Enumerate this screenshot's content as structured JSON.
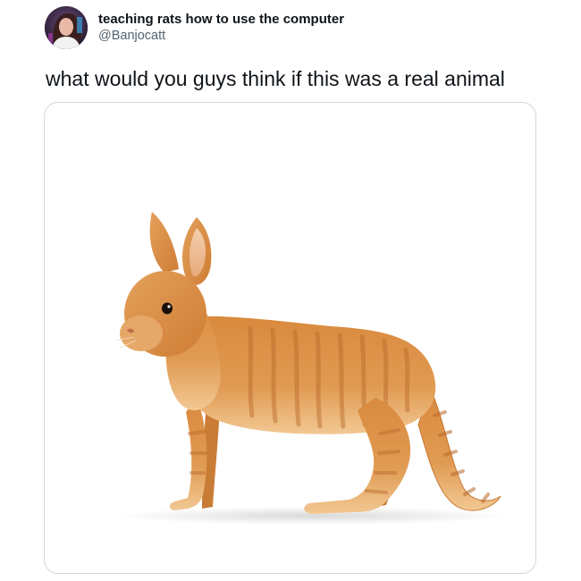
{
  "tweet": {
    "author": {
      "display_name": "teaching rats how to use the computer",
      "handle": "@Banjocatt",
      "avatar_icon": "profile-avatar"
    },
    "text": "what would you guys think if this was a real animal",
    "media": {
      "icon": "rabbit-cat-hybrid-image",
      "background_color": "#ffffff"
    }
  },
  "colors": {
    "text_primary": "#0f1419",
    "text_secondary": "#536471",
    "card_border": "#cfd9de",
    "fur_main": "#d9904a",
    "fur_light": "#f0c48a"
  }
}
